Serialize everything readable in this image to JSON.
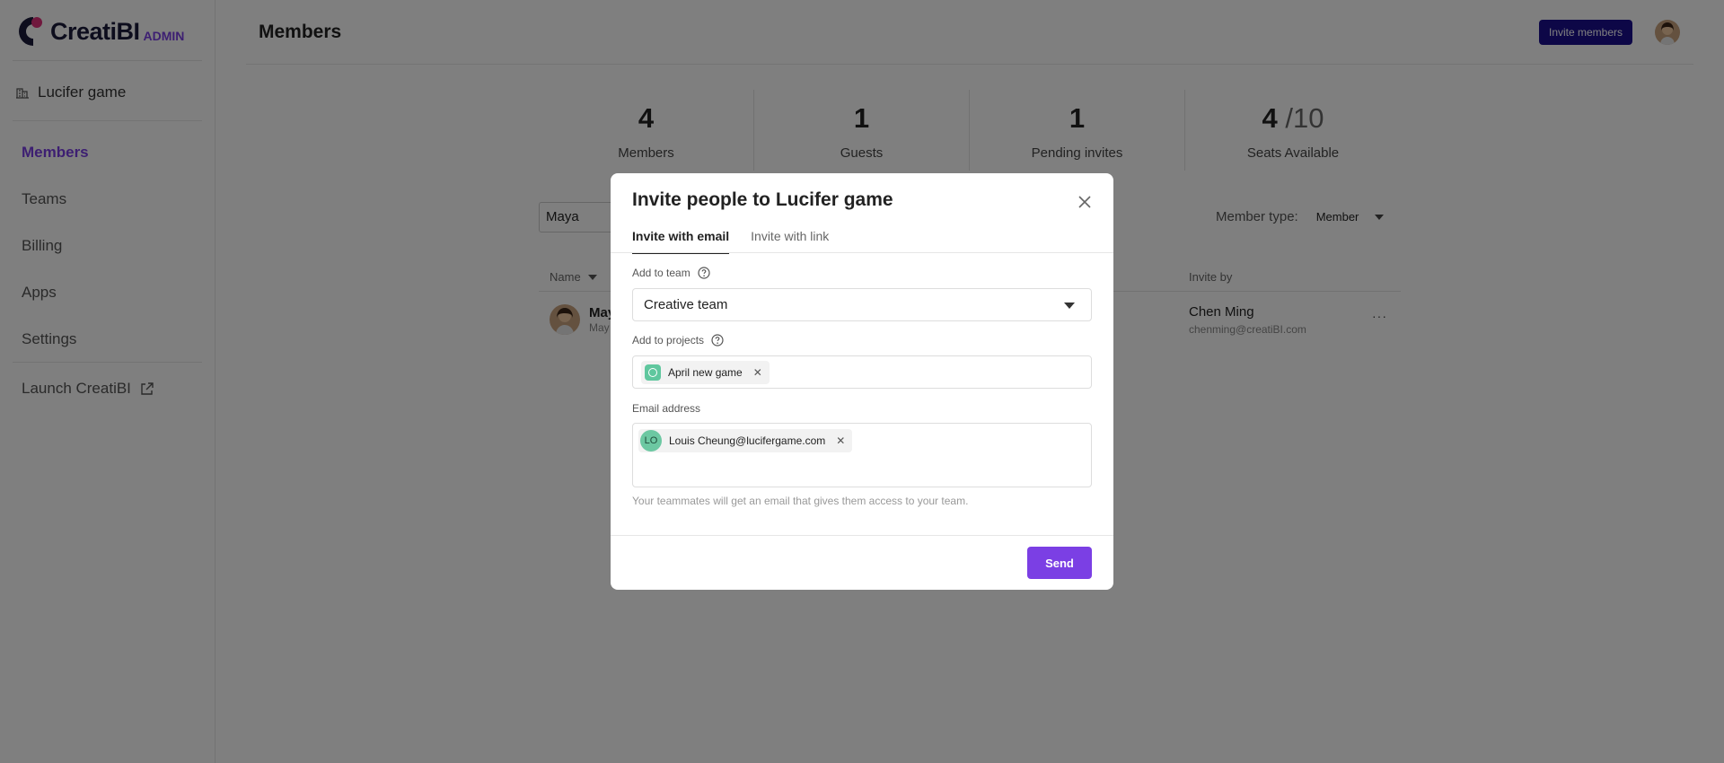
{
  "app": {
    "logo_text": "CreatiBI",
    "logo_badge": "ADMIN"
  },
  "sidebar": {
    "workspace": "Lucifer game",
    "items": [
      {
        "label": "Members",
        "active": true
      },
      {
        "label": "Teams"
      },
      {
        "label": "Billing"
      },
      {
        "label": "Apps"
      },
      {
        "label": "Settings"
      }
    ],
    "launch_label": "Launch CreatiBI"
  },
  "header": {
    "title": "Members",
    "invite_button": "Invite members"
  },
  "stats": [
    {
      "value": "4",
      "label": "Members"
    },
    {
      "value": "1",
      "label": "Guests"
    },
    {
      "value": "1",
      "label": "Pending invites"
    },
    {
      "value": "4",
      "sub": "/10",
      "label": "Seats Available"
    }
  ],
  "filters": {
    "search_value": "Maya",
    "member_type_label": "Member type:",
    "member_type_value": "Member"
  },
  "table": {
    "col_name": "Name",
    "col_invite_by": "Invite by",
    "rows": [
      {
        "name": "May",
        "sub": "May",
        "invite_by_name": "Chen Ming",
        "invite_by_email": "chenming@creatiBI.com",
        "more": "···"
      }
    ]
  },
  "modal": {
    "title": "Invite people to Lucifer game",
    "tabs": [
      "Invite with email",
      "Invite with link"
    ],
    "team_label": "Add to team",
    "team_value": "Creative team",
    "projects_label": "Add to projects",
    "project_chip": "April new game",
    "email_label": "Email address",
    "email_chip_initials": "LO",
    "email_chip": "Louis Cheung@lucifergame.com",
    "hint": "Your teammates will get an email that gives them access to your team.",
    "send_button": "Send",
    "chip_remove": "✕"
  },
  "colors": {
    "accent": "#7b3fe4",
    "primary_dark": "#1a0f8f",
    "project_green": "#5fc79e"
  }
}
